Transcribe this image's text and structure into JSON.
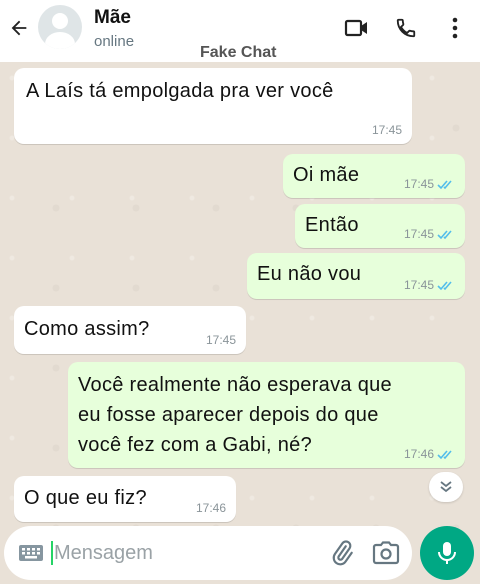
{
  "header": {
    "contact_name": "Mãe",
    "status": "online",
    "watermark": "Fake Chat"
  },
  "icons": {
    "back": "arrow-left-icon",
    "video": "video-camera-icon",
    "call": "phone-icon",
    "menu": "more-vertical-icon"
  },
  "messages": [
    {
      "direction": "in",
      "text": "A Laís tá empolgada pra ver você",
      "time": "17:45"
    },
    {
      "direction": "out",
      "text": "Oi mãe",
      "time": "17:45",
      "read": true
    },
    {
      "direction": "out",
      "text": "Então",
      "time": "17:45",
      "read": true
    },
    {
      "direction": "out",
      "text": "Eu não vou",
      "time": "17:45",
      "read": true
    },
    {
      "direction": "in",
      "text": "Como assim?",
      "time": "17:45"
    },
    {
      "direction": "out",
      "text_lines": [
        "Você realmente não esperava que",
        "eu fosse aparecer depois do que",
        "você fez com a Gabi, né?"
      ],
      "time": "17:46",
      "read": true
    },
    {
      "direction": "in",
      "text": "O que eu fiz?",
      "time": "17:46"
    }
  ],
  "composer": {
    "placeholder": "Mensagem"
  },
  "colors": {
    "outgoing_bubble": "#e7ffdb",
    "incoming_bubble": "#ffffff",
    "read_ticks": "#53bdeb",
    "accent": "#00a884"
  }
}
